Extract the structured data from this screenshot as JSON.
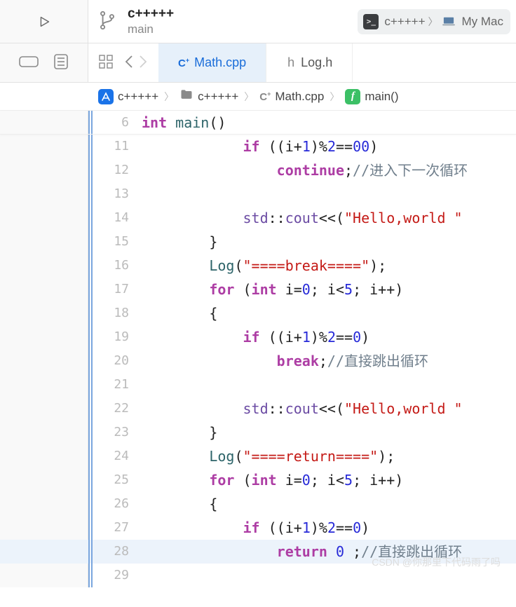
{
  "toolbar": {
    "project_name": "c+++++",
    "branch_name": "main",
    "scheme_app": "c+++++",
    "scheme_dest": "My Mac"
  },
  "tabs": [
    {
      "icon": "C+",
      "label": "Math.cpp",
      "active": true
    },
    {
      "icon": "h",
      "label": "Log.h",
      "active": false
    }
  ],
  "breadcrumb": {
    "project": "c+++++",
    "folder": "c+++++",
    "file": "Math.cpp",
    "symbol": "main()"
  },
  "sticky": {
    "line_num": "6",
    "tokens": [
      {
        "t": "kw",
        "v": "int"
      },
      {
        "t": "plain",
        "v": " "
      },
      {
        "t": "fn",
        "v": "main"
      },
      {
        "t": "plain",
        "v": "()"
      }
    ]
  },
  "code": [
    {
      "n": "11",
      "hl": false,
      "ind": 3,
      "tokens": [
        {
          "t": "kw",
          "v": "if"
        },
        {
          "t": "plain",
          "v": " ((i+"
        },
        {
          "t": "num",
          "v": "1"
        },
        {
          "t": "plain",
          "v": ")%"
        },
        {
          "t": "num",
          "v": "2"
        },
        {
          "t": "plain",
          "v": "=="
        },
        {
          "t": "num",
          "v": "00"
        },
        {
          "t": "plain",
          "v": ")"
        }
      ]
    },
    {
      "n": "12",
      "hl": false,
      "ind": 4,
      "tokens": [
        {
          "t": "kw",
          "v": "continue"
        },
        {
          "t": "plain",
          "v": ";"
        },
        {
          "t": "cmt",
          "v": "//进入下一次循环"
        }
      ]
    },
    {
      "n": "13",
      "hl": false,
      "ind": 0,
      "tokens": []
    },
    {
      "n": "14",
      "hl": false,
      "ind": 3,
      "tokens": [
        {
          "t": "ns",
          "v": "std"
        },
        {
          "t": "plain",
          "v": "::"
        },
        {
          "t": "ns",
          "v": "cout"
        },
        {
          "t": "plain",
          "v": "<<("
        },
        {
          "t": "str",
          "v": "\"Hello,world \""
        }
      ]
    },
    {
      "n": "15",
      "hl": false,
      "ind": 2,
      "tokens": [
        {
          "t": "plain",
          "v": "}"
        }
      ]
    },
    {
      "n": "16",
      "hl": false,
      "ind": 2,
      "tokens": [
        {
          "t": "fn",
          "v": "Log"
        },
        {
          "t": "plain",
          "v": "("
        },
        {
          "t": "str",
          "v": "\"====break====\""
        },
        {
          "t": "plain",
          "v": ");"
        }
      ]
    },
    {
      "n": "17",
      "hl": false,
      "ind": 2,
      "tokens": [
        {
          "t": "kw",
          "v": "for"
        },
        {
          "t": "plain",
          "v": " ("
        },
        {
          "t": "kw",
          "v": "int"
        },
        {
          "t": "plain",
          "v": " i="
        },
        {
          "t": "num",
          "v": "0"
        },
        {
          "t": "plain",
          "v": "; i<"
        },
        {
          "t": "num",
          "v": "5"
        },
        {
          "t": "plain",
          "v": "; i++)"
        }
      ]
    },
    {
      "n": "18",
      "hl": false,
      "ind": 2,
      "tokens": [
        {
          "t": "plain",
          "v": "{"
        }
      ]
    },
    {
      "n": "19",
      "hl": false,
      "ind": 3,
      "tokens": [
        {
          "t": "kw",
          "v": "if"
        },
        {
          "t": "plain",
          "v": " ((i+"
        },
        {
          "t": "num",
          "v": "1"
        },
        {
          "t": "plain",
          "v": ")%"
        },
        {
          "t": "num",
          "v": "2"
        },
        {
          "t": "plain",
          "v": "=="
        },
        {
          "t": "num",
          "v": "0"
        },
        {
          "t": "plain",
          "v": ")"
        }
      ]
    },
    {
      "n": "20",
      "hl": false,
      "ind": 4,
      "tokens": [
        {
          "t": "kw",
          "v": "break"
        },
        {
          "t": "plain",
          "v": ";"
        },
        {
          "t": "cmt",
          "v": "//直接跳出循环"
        }
      ]
    },
    {
      "n": "21",
      "hl": false,
      "ind": 0,
      "tokens": []
    },
    {
      "n": "22",
      "hl": false,
      "ind": 3,
      "tokens": [
        {
          "t": "ns",
          "v": "std"
        },
        {
          "t": "plain",
          "v": "::"
        },
        {
          "t": "ns",
          "v": "cout"
        },
        {
          "t": "plain",
          "v": "<<("
        },
        {
          "t": "str",
          "v": "\"Hello,world \""
        }
      ]
    },
    {
      "n": "23",
      "hl": false,
      "ind": 2,
      "tokens": [
        {
          "t": "plain",
          "v": "}"
        }
      ]
    },
    {
      "n": "24",
      "hl": false,
      "ind": 2,
      "tokens": [
        {
          "t": "fn",
          "v": "Log"
        },
        {
          "t": "plain",
          "v": "("
        },
        {
          "t": "str",
          "v": "\"====return====\""
        },
        {
          "t": "plain",
          "v": ");"
        }
      ]
    },
    {
      "n": "25",
      "hl": false,
      "ind": 2,
      "tokens": [
        {
          "t": "kw",
          "v": "for"
        },
        {
          "t": "plain",
          "v": " ("
        },
        {
          "t": "kw",
          "v": "int"
        },
        {
          "t": "plain",
          "v": " i="
        },
        {
          "t": "num",
          "v": "0"
        },
        {
          "t": "plain",
          "v": "; i<"
        },
        {
          "t": "num",
          "v": "5"
        },
        {
          "t": "plain",
          "v": "; i++)"
        }
      ]
    },
    {
      "n": "26",
      "hl": false,
      "ind": 2,
      "tokens": [
        {
          "t": "plain",
          "v": "{"
        }
      ]
    },
    {
      "n": "27",
      "hl": false,
      "ind": 3,
      "tokens": [
        {
          "t": "kw",
          "v": "if"
        },
        {
          "t": "plain",
          "v": " ((i+"
        },
        {
          "t": "num",
          "v": "1"
        },
        {
          "t": "plain",
          "v": ")%"
        },
        {
          "t": "num",
          "v": "2"
        },
        {
          "t": "plain",
          "v": "=="
        },
        {
          "t": "num",
          "v": "0"
        },
        {
          "t": "plain",
          "v": ")"
        }
      ]
    },
    {
      "n": "28",
      "hl": true,
      "ind": 4,
      "tokens": [
        {
          "t": "kw",
          "v": "return"
        },
        {
          "t": "plain",
          "v": " "
        },
        {
          "t": "num",
          "v": "0"
        },
        {
          "t": "plain",
          "v": " ;"
        },
        {
          "t": "cmt",
          "v": "//直接跳出循环"
        }
      ]
    },
    {
      "n": "29",
      "hl": false,
      "ind": 0,
      "tokens": []
    }
  ],
  "watermark": "CSDN @你那里下代码雨了吗"
}
